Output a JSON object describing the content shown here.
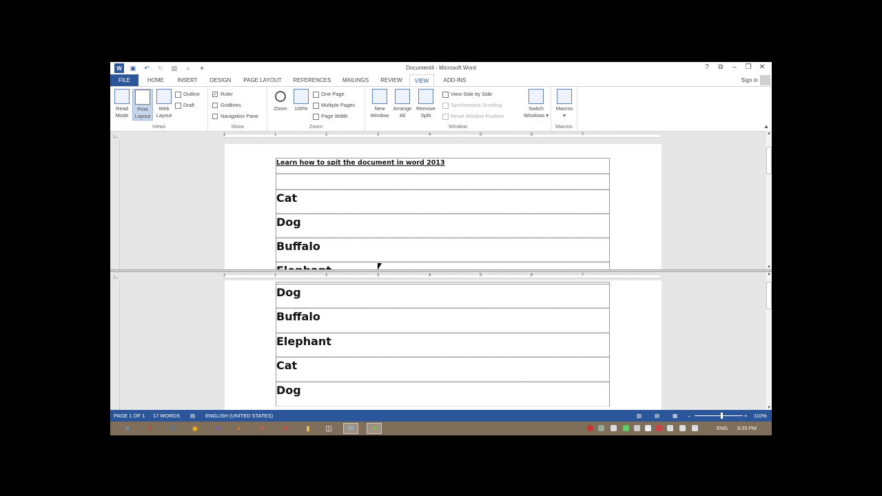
{
  "window": {
    "title": "Document4 - Microsoft Word",
    "controls": [
      "?",
      "⧉",
      "–",
      "❐",
      "✕"
    ]
  },
  "tabs": [
    "FILE",
    "HOME",
    "INSERT",
    "DESIGN",
    "PAGE LAYOUT",
    "REFERENCES",
    "MAILINGS",
    "REVIEW",
    "VIEW",
    "ADD-INS"
  ],
  "active_tab": "VIEW",
  "sign_in": "Sign in",
  "ribbon": {
    "views": {
      "label": "Views",
      "read_mode": [
        "Read",
        "Mode"
      ],
      "print_layout": [
        "Print",
        "Layout"
      ],
      "web_layout": [
        "Web",
        "Layout"
      ],
      "outline": "Outline",
      "draft": "Draft"
    },
    "show": {
      "label": "Show",
      "ruler": "Ruler",
      "ruler_checked": true,
      "gridlines": "Gridlines",
      "gridlines_checked": false,
      "navigation_pane": "Navigation Pane",
      "navigation_pane_checked": false
    },
    "zoom": {
      "label": "Zoom",
      "zoom": "Zoom",
      "hundred": "100%",
      "one_page": "One Page",
      "multiple_pages": "Multiple Pages",
      "page_width": "Page Width"
    },
    "window": {
      "label": "Window",
      "new_window": [
        "New",
        "Window"
      ],
      "arrange_all": [
        "Arrange",
        "All"
      ],
      "remove_split": [
        "Remove",
        "Split"
      ],
      "view_side_by_side": "View Side by Side",
      "synchronous_scrolling": "Synchronous Scrolling",
      "reset_window_position": "Reset Window Position",
      "switch_windows": [
        "Switch",
        "Windows ▾"
      ]
    },
    "macros": {
      "label": "Macros",
      "macros": [
        "Macros",
        "▾"
      ]
    }
  },
  "ruler_numbers": [
    "1",
    "1",
    "2",
    "3",
    "4",
    "5",
    "6",
    "7"
  ],
  "document": {
    "heading": "Learn how to spit the document in word 2013",
    "pane1_rows": [
      "Cat",
      "Dog",
      "Buffalo",
      "Elephant"
    ],
    "pane2_rows": [
      "Dog",
      "Buffalo",
      "Elephant",
      "Cat",
      "Dog"
    ]
  },
  "status": {
    "page": "PAGE 1 OF 1",
    "words": "17 WORDS",
    "language": "ENGLISH (UNITED STATES)",
    "zoom": "110%",
    "zoom_level": 0.55
  },
  "taskbar": {
    "lang": "ENG",
    "time": "9:25 PM"
  }
}
